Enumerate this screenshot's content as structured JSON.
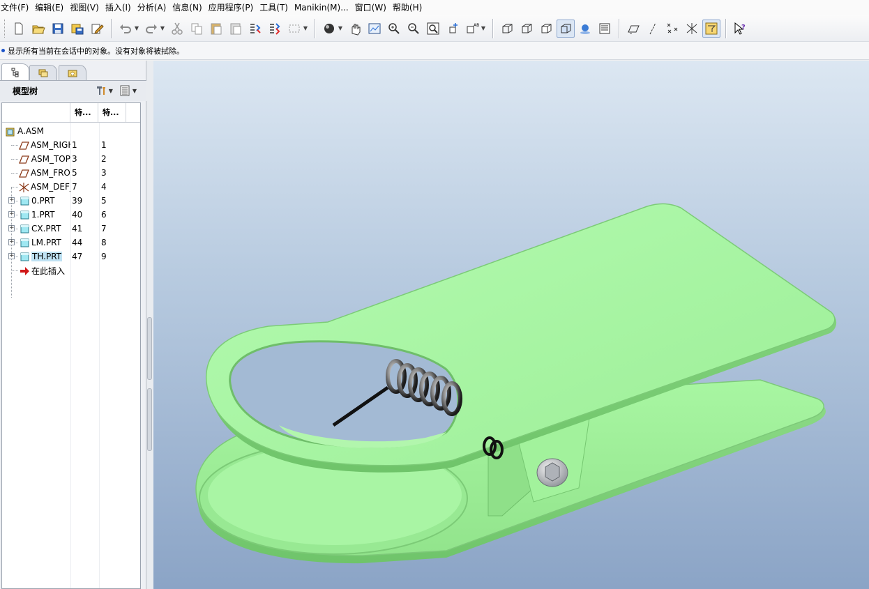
{
  "menu": [
    "文件(F)",
    "编辑(E)",
    "视图(V)",
    "插入(I)",
    "分析(A)",
    "信息(N)",
    "应用程序(P)",
    "工具(T)",
    "Manikin(M)...",
    "窗口(W)",
    "帮助(H)"
  ],
  "toolbar": {
    "groups": [
      [
        "new-icon",
        "open-icon",
        "save-icon",
        "save-as-icon",
        "edit-icon"
      ],
      [
        "undo-icon",
        "redo-icon",
        "cut-icon",
        "copy-icon",
        "paste-icon",
        "paste-special-icon",
        "regenerate-icon",
        "regenerate-manager-icon",
        "select-box-icon"
      ],
      [
        "appearance-icon",
        "spin-center-icon",
        "refit-icon",
        "zoom-in-icon",
        "zoom-out-icon",
        "zoom-window-icon",
        "reorient-icon",
        "saved-views-icon"
      ],
      [
        "wireframe-icon",
        "hidden-line-icon",
        "no-hidden-icon",
        "shading-icon",
        "enhanced-realism-icon",
        "layers-icon"
      ],
      [
        "datum-planes-icon",
        "datum-axes-icon",
        "datum-points-icon",
        "coord-sys-icon",
        "annotations-icon"
      ],
      [
        "context-help-icon"
      ]
    ]
  },
  "message": "显示所有当前在会话中的对象。没有对象将被拭除。",
  "model_tree": {
    "tabs": [
      "model-tree-tab",
      "folder-browser-tab",
      "favorites-tab"
    ],
    "title": "模型树",
    "columns": [
      "特...",
      "特..."
    ],
    "rows": [
      {
        "name": "A.ASM",
        "v1": "",
        "v2": "",
        "icon": "assembly-icon",
        "indent": 0,
        "expandable": false,
        "selected": false
      },
      {
        "name": "ASM_RIGHT",
        "v1": "1",
        "v2": "1",
        "icon": "datum-plane-icon",
        "indent": 1,
        "expandable": false,
        "selected": false
      },
      {
        "name": "ASM_TOP",
        "v1": "3",
        "v2": "2",
        "icon": "datum-plane-icon",
        "indent": 1,
        "expandable": false,
        "selected": false
      },
      {
        "name": "ASM_FRONT",
        "v1": "5",
        "v2": "3",
        "icon": "datum-plane-icon",
        "indent": 1,
        "expandable": false,
        "selected": false
      },
      {
        "name": "ASM_DEF_CSYS",
        "v1": "7",
        "v2": "4",
        "icon": "csys-icon",
        "indent": 1,
        "expandable": false,
        "selected": false
      },
      {
        "name": "0.PRT",
        "v1": "39",
        "v2": "5",
        "icon": "part-icon",
        "indent": 1,
        "expandable": true,
        "selected": false
      },
      {
        "name": "1.PRT",
        "v1": "40",
        "v2": "6",
        "icon": "part-icon",
        "indent": 1,
        "expandable": true,
        "selected": false
      },
      {
        "name": "CX.PRT",
        "v1": "41",
        "v2": "7",
        "icon": "part-icon",
        "indent": 1,
        "expandable": true,
        "selected": false
      },
      {
        "name": "LM.PRT",
        "v1": "44",
        "v2": "8",
        "icon": "part-icon",
        "indent": 1,
        "expandable": true,
        "selected": false
      },
      {
        "name": "TH.PRT",
        "v1": "47",
        "v2": "9",
        "icon": "part-icon",
        "indent": 1,
        "expandable": true,
        "selected": true
      },
      {
        "name": "在此插入",
        "v1": "",
        "v2": "",
        "icon": "insert-here-icon",
        "indent": 1,
        "expandable": false,
        "selected": false
      }
    ]
  },
  "colors": {
    "part_green": "#a6f5a0",
    "part_edge": "#7fcf7a",
    "viewport_top": "#dce7f2",
    "viewport_bottom": "#8ba4c6",
    "selection": "#bfe2f3"
  }
}
